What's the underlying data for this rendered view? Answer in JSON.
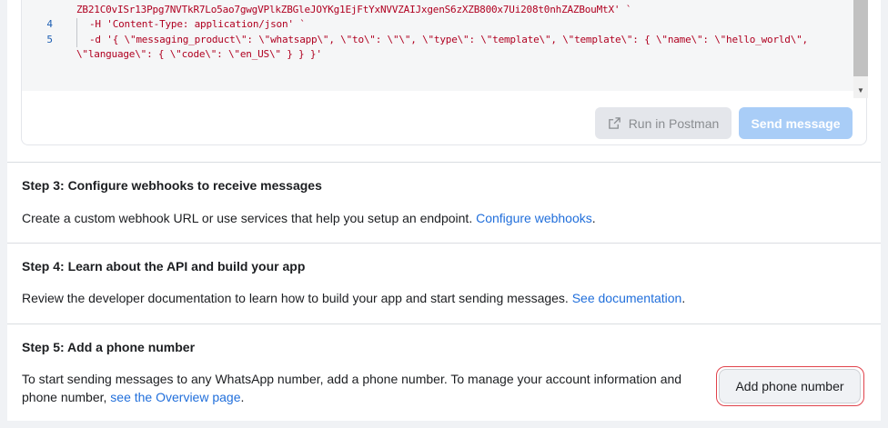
{
  "code": {
    "line3_text": "ZB21C0vISr13Ppg7NVTkR7Lo5ao7gwgVPlkZBGleJOYKg1EjFtYxNVVZAIJxgenS6zXZB800x7Ui208t0nhZAZBouMtX' `",
    "line4_number": "4",
    "line4_text": "-H 'Content-Type: application/json' `",
    "line5_number": "5",
    "line5_text": "-d '{ \\\"messaging_product\\\": \\\"whatsapp\\\", \\\"to\\\": \\\"\\\", \\\"type\\\": \\\"template\\\", \\\"template\\\": { \\\"name\\\": \\\"hello_world\\\",",
    "line5_wrap": "\\\"language\\\": { \\\"code\\\": \\\"en_US\\\" } } }'"
  },
  "actions": {
    "postman_label": "Run in Postman",
    "send_label": "Send message"
  },
  "step3": {
    "title": "Step 3: Configure webhooks to receive messages",
    "text": "Create a custom webhook URL or use services that help you setup an endpoint. ",
    "link": "Configure webhooks",
    "after": "."
  },
  "step4": {
    "title": "Step 4: Learn about the API and build your app",
    "text": "Review the developer documentation to learn how to build your app and start sending messages. ",
    "link": "See documentation",
    "after": "."
  },
  "step5": {
    "title": "Step 5: Add a phone number",
    "text_line1": "To start sending messages to any WhatsApp number, add a phone number. To manage your account information and",
    "text_line2": "phone number, ",
    "link": "see the Overview page",
    "after": ".",
    "button_label": "Add phone number"
  },
  "icons": {
    "postman_icon": "external-link-icon",
    "scroll_down": "triangle-down-icon"
  }
}
